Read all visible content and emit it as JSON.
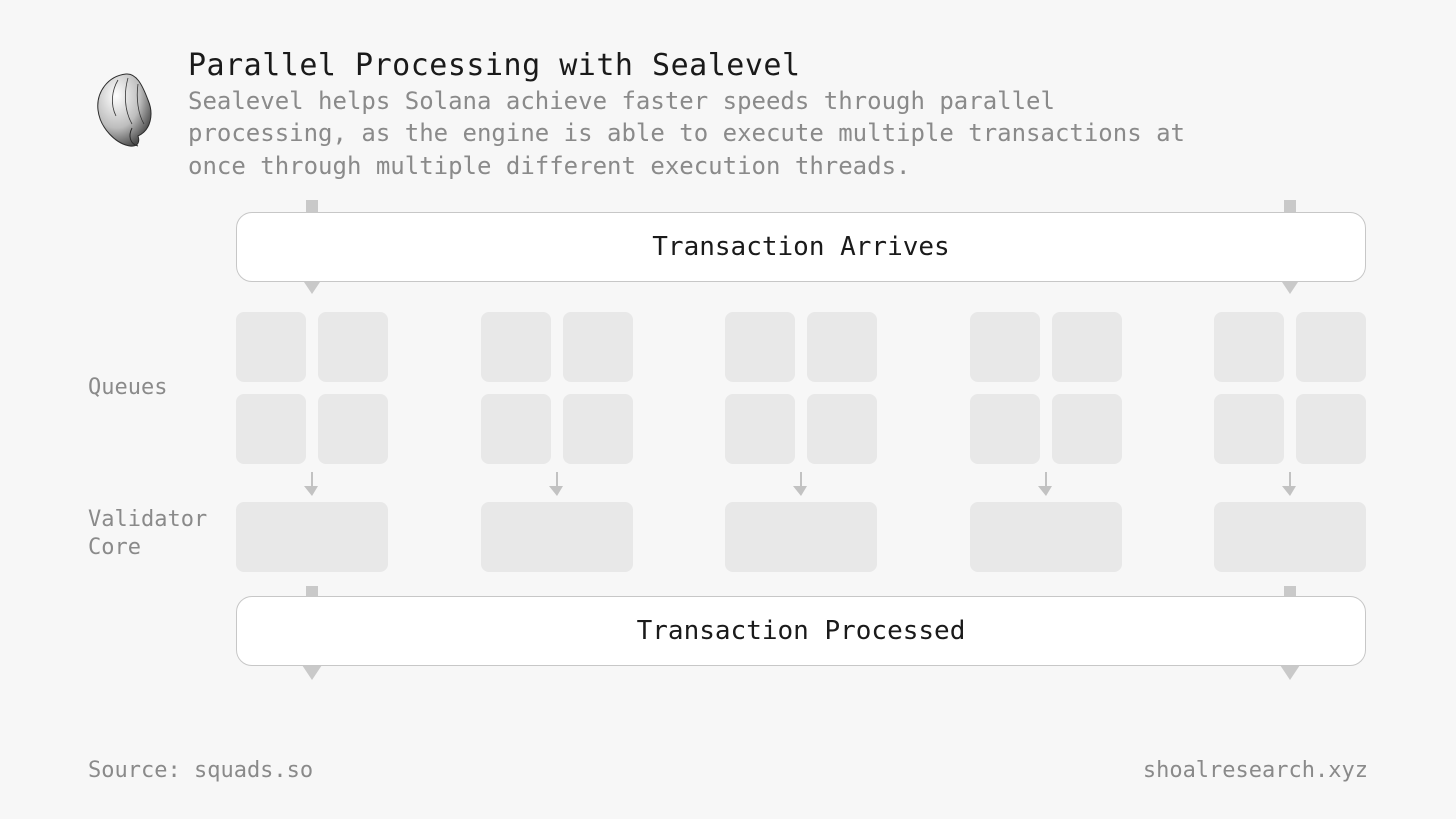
{
  "header": {
    "title": "Parallel Processing with Sealevel",
    "subtitle": "Sealevel helps Solana achieve faster speeds through parallel processing, as the engine is able to execute multiple transactions at once through multiple different execution threads."
  },
  "banner_top": "Transaction Arrives",
  "banner_bottom": "Transaction Processed",
  "labels": {
    "queues": "Queues",
    "validator_core": "Validator\nCore"
  },
  "lane_count": 5,
  "footer": {
    "source": "Source: squads.so",
    "brand": "shoalresearch.xyz"
  }
}
